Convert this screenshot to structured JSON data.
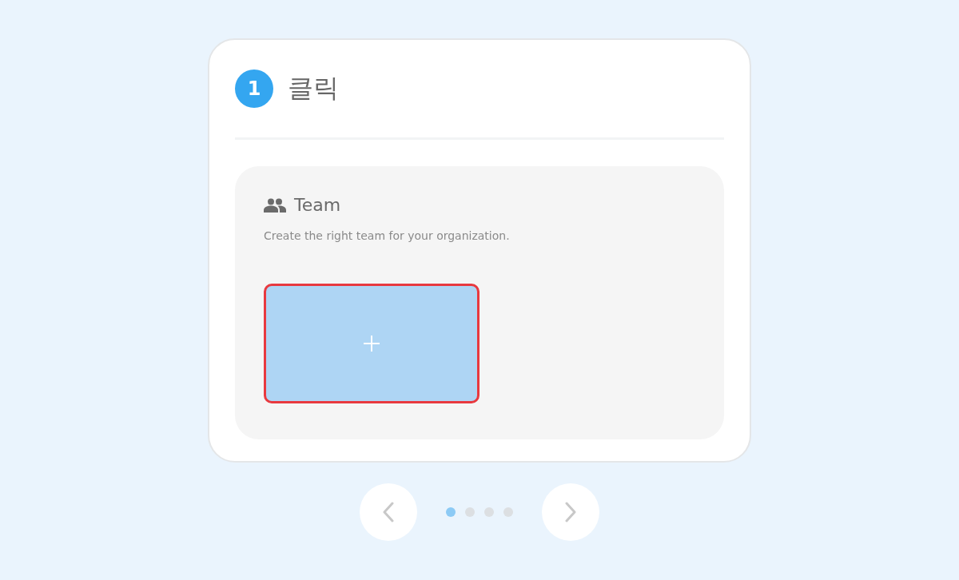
{
  "step": {
    "number": "1",
    "title": "클릭"
  },
  "panel": {
    "title": "Team",
    "description": "Create the right team for your organization.",
    "add_tile": {
      "highlighted": true
    }
  },
  "pagination": {
    "dots": [
      {
        "selected": true
      },
      {
        "selected": false
      },
      {
        "selected": false
      },
      {
        "selected": false
      }
    ]
  }
}
